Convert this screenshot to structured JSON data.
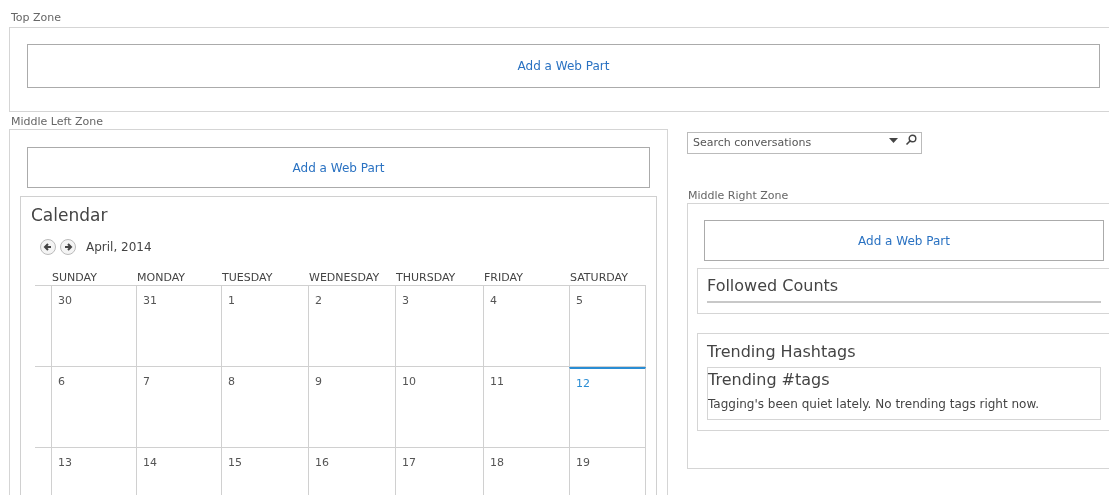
{
  "top_zone": {
    "label": "Top Zone",
    "add_button": "Add a Web Part"
  },
  "middle_left_zone": {
    "label": "Middle Left Zone",
    "add_button": "Add a Web Part",
    "calendar": {
      "title": "Calendar",
      "month": "April, 2014",
      "days_of_week": [
        "SUNDAY",
        "MONDAY",
        "TUESDAY",
        "WEDNESDAY",
        "THURSDAY",
        "FRIDAY",
        "SATURDAY"
      ],
      "weeks": [
        [
          {
            "label": "30",
            "today": false
          },
          {
            "label": "31",
            "today": false
          },
          {
            "label": "1",
            "today": false
          },
          {
            "label": "2",
            "today": false
          },
          {
            "label": "3",
            "today": false
          },
          {
            "label": "4",
            "today": false
          },
          {
            "label": "5",
            "today": false
          }
        ],
        [
          {
            "label": "6",
            "today": false
          },
          {
            "label": "7",
            "today": false
          },
          {
            "label": "8",
            "today": false
          },
          {
            "label": "9",
            "today": false
          },
          {
            "label": "10",
            "today": false
          },
          {
            "label": "11",
            "today": false
          },
          {
            "label": "12",
            "today": true
          }
        ],
        [
          {
            "label": "13",
            "today": false
          },
          {
            "label": "14",
            "today": false
          },
          {
            "label": "15",
            "today": false
          },
          {
            "label": "16",
            "today": false
          },
          {
            "label": "17",
            "today": false
          },
          {
            "label": "18",
            "today": false
          },
          {
            "label": "19",
            "today": false
          }
        ]
      ]
    }
  },
  "search": {
    "placeholder": "Search conversations"
  },
  "middle_right_zone": {
    "label": "Middle Right Zone",
    "add_button": "Add a Web Part",
    "followed_counts": {
      "title": "Followed Counts"
    },
    "trending_hashtags": {
      "title": "Trending Hashtags",
      "subtitle": "Trending #tags",
      "message": "Tagging's been quiet lately. No trending tags right now."
    }
  }
}
